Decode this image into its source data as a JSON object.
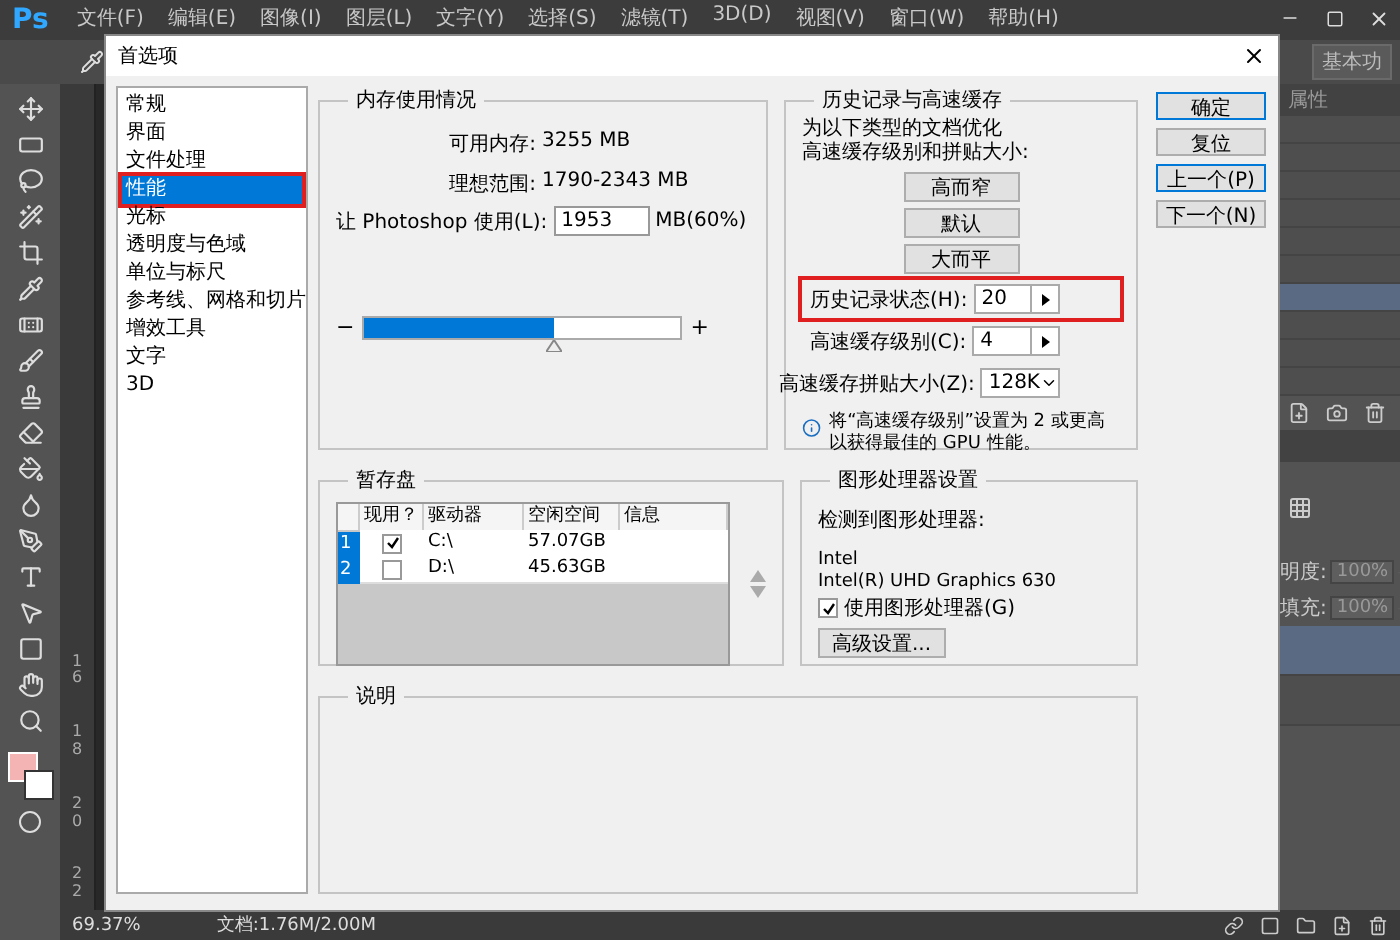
{
  "app": {
    "logo": "Ps",
    "menu": [
      "文件(F)",
      "编辑(E)",
      "图像(I)",
      "图层(L)",
      "文字(Y)",
      "选择(S)",
      "滤镜(T)",
      "3D(D)",
      "视图(V)",
      "窗口(W)",
      "帮助(H)"
    ],
    "workspace": "基本功",
    "ruler_labels": [
      "16",
      "18",
      "20",
      "22"
    ],
    "panel_tab": "属性",
    "history_rows": [
      {
        "selected": false
      },
      {
        "selected": false
      },
      {
        "selected": false
      },
      {
        "selected": false
      },
      {
        "selected": false
      },
      {
        "selected": false
      },
      {
        "selected": true
      },
      {
        "selected": false
      },
      {
        "selected": false
      },
      {
        "selected": false
      }
    ],
    "layer_settings": [
      {
        "label": "明度:",
        "value": "100%"
      },
      {
        "label": "填充:",
        "value": "100%"
      }
    ],
    "layer_rows": [
      {
        "selected": true
      },
      {
        "selected": false
      }
    ],
    "status_bar": {
      "zoom": "69.37%",
      "document": "文档:1.76M/2.00M"
    }
  },
  "dialog": {
    "title": "首选项",
    "categories": [
      {
        "label": "常规",
        "selected": false,
        "highlighted": false
      },
      {
        "label": "界面",
        "selected": false,
        "highlighted": false
      },
      {
        "label": "文件处理",
        "selected": false,
        "highlighted": false
      },
      {
        "label": "性能",
        "selected": true,
        "highlighted": true
      },
      {
        "label": "光标",
        "selected": false,
        "highlighted": false
      },
      {
        "label": "透明度与色域",
        "selected": false,
        "highlighted": false
      },
      {
        "label": "单位与标尺",
        "selected": false,
        "highlighted": false
      },
      {
        "label": "参考线、网格和切片",
        "selected": false,
        "highlighted": false
      },
      {
        "label": "增效工具",
        "selected": false,
        "highlighted": false
      },
      {
        "label": "文字",
        "selected": false,
        "highlighted": false
      },
      {
        "label": "3D",
        "selected": false,
        "highlighted": false
      }
    ],
    "memory": {
      "title": "内存使用情况",
      "rows": [
        {
          "label": "可用内存:",
          "value": "3255 MB"
        },
        {
          "label": "理想范围:",
          "value": "1790-2343 MB"
        }
      ],
      "use_label": "让 Photoshop 使用(L):",
      "use_value": "1953",
      "unit": "MB(60%)",
      "minus": "−",
      "plus": "+",
      "level": 0.6
    },
    "history": {
      "title": "历史记录与高速缓存",
      "intro": [
        "为以下类型的文档优化",
        "高速缓存级别和拼贴大小:"
      ],
      "presets": [
        "高而窄",
        "默认",
        "大而平"
      ],
      "fields": [
        {
          "kind": "stepper",
          "label": "历史记录状态(H):",
          "value": "20",
          "highlighted": true
        },
        {
          "kind": "stepper",
          "label": "高速缓存级别(C):",
          "value": "4",
          "highlighted": false
        },
        {
          "kind": "dropdown",
          "label": "高速缓存拼贴大小(Z):",
          "value": "128K",
          "highlighted": false
        }
      ],
      "note": "将“高速缓存级别”设置为 2 或更高以获得最佳的 GPU 性能。"
    },
    "scratch": {
      "title": "暂存盘",
      "columns": [
        "现用？",
        "驱动器",
        "空闲空间",
        "信息"
      ],
      "rows": [
        {
          "index": "1",
          "active": true,
          "drive": "C:\\",
          "free": "57.07GB"
        },
        {
          "index": "2",
          "active": false,
          "drive": "D:\\",
          "free": "45.63GB"
        }
      ]
    },
    "gpu": {
      "title": "图形处理器设置",
      "detected": "检测到图形处理器:",
      "lines": [
        "Intel",
        "Intel(R) UHD Graphics 630"
      ],
      "use_gpu": {
        "label": "使用图形处理器(G)",
        "checked": true
      },
      "advanced": "高级设置..."
    },
    "description": {
      "title": "说明"
    },
    "side_buttons": [
      {
        "label": "确定",
        "focused": true
      },
      {
        "label": "复位",
        "focused": false
      },
      {
        "label": "上一个(P)",
        "focused": true
      },
      {
        "label": "下一个(N)",
        "focused": false
      }
    ]
  }
}
